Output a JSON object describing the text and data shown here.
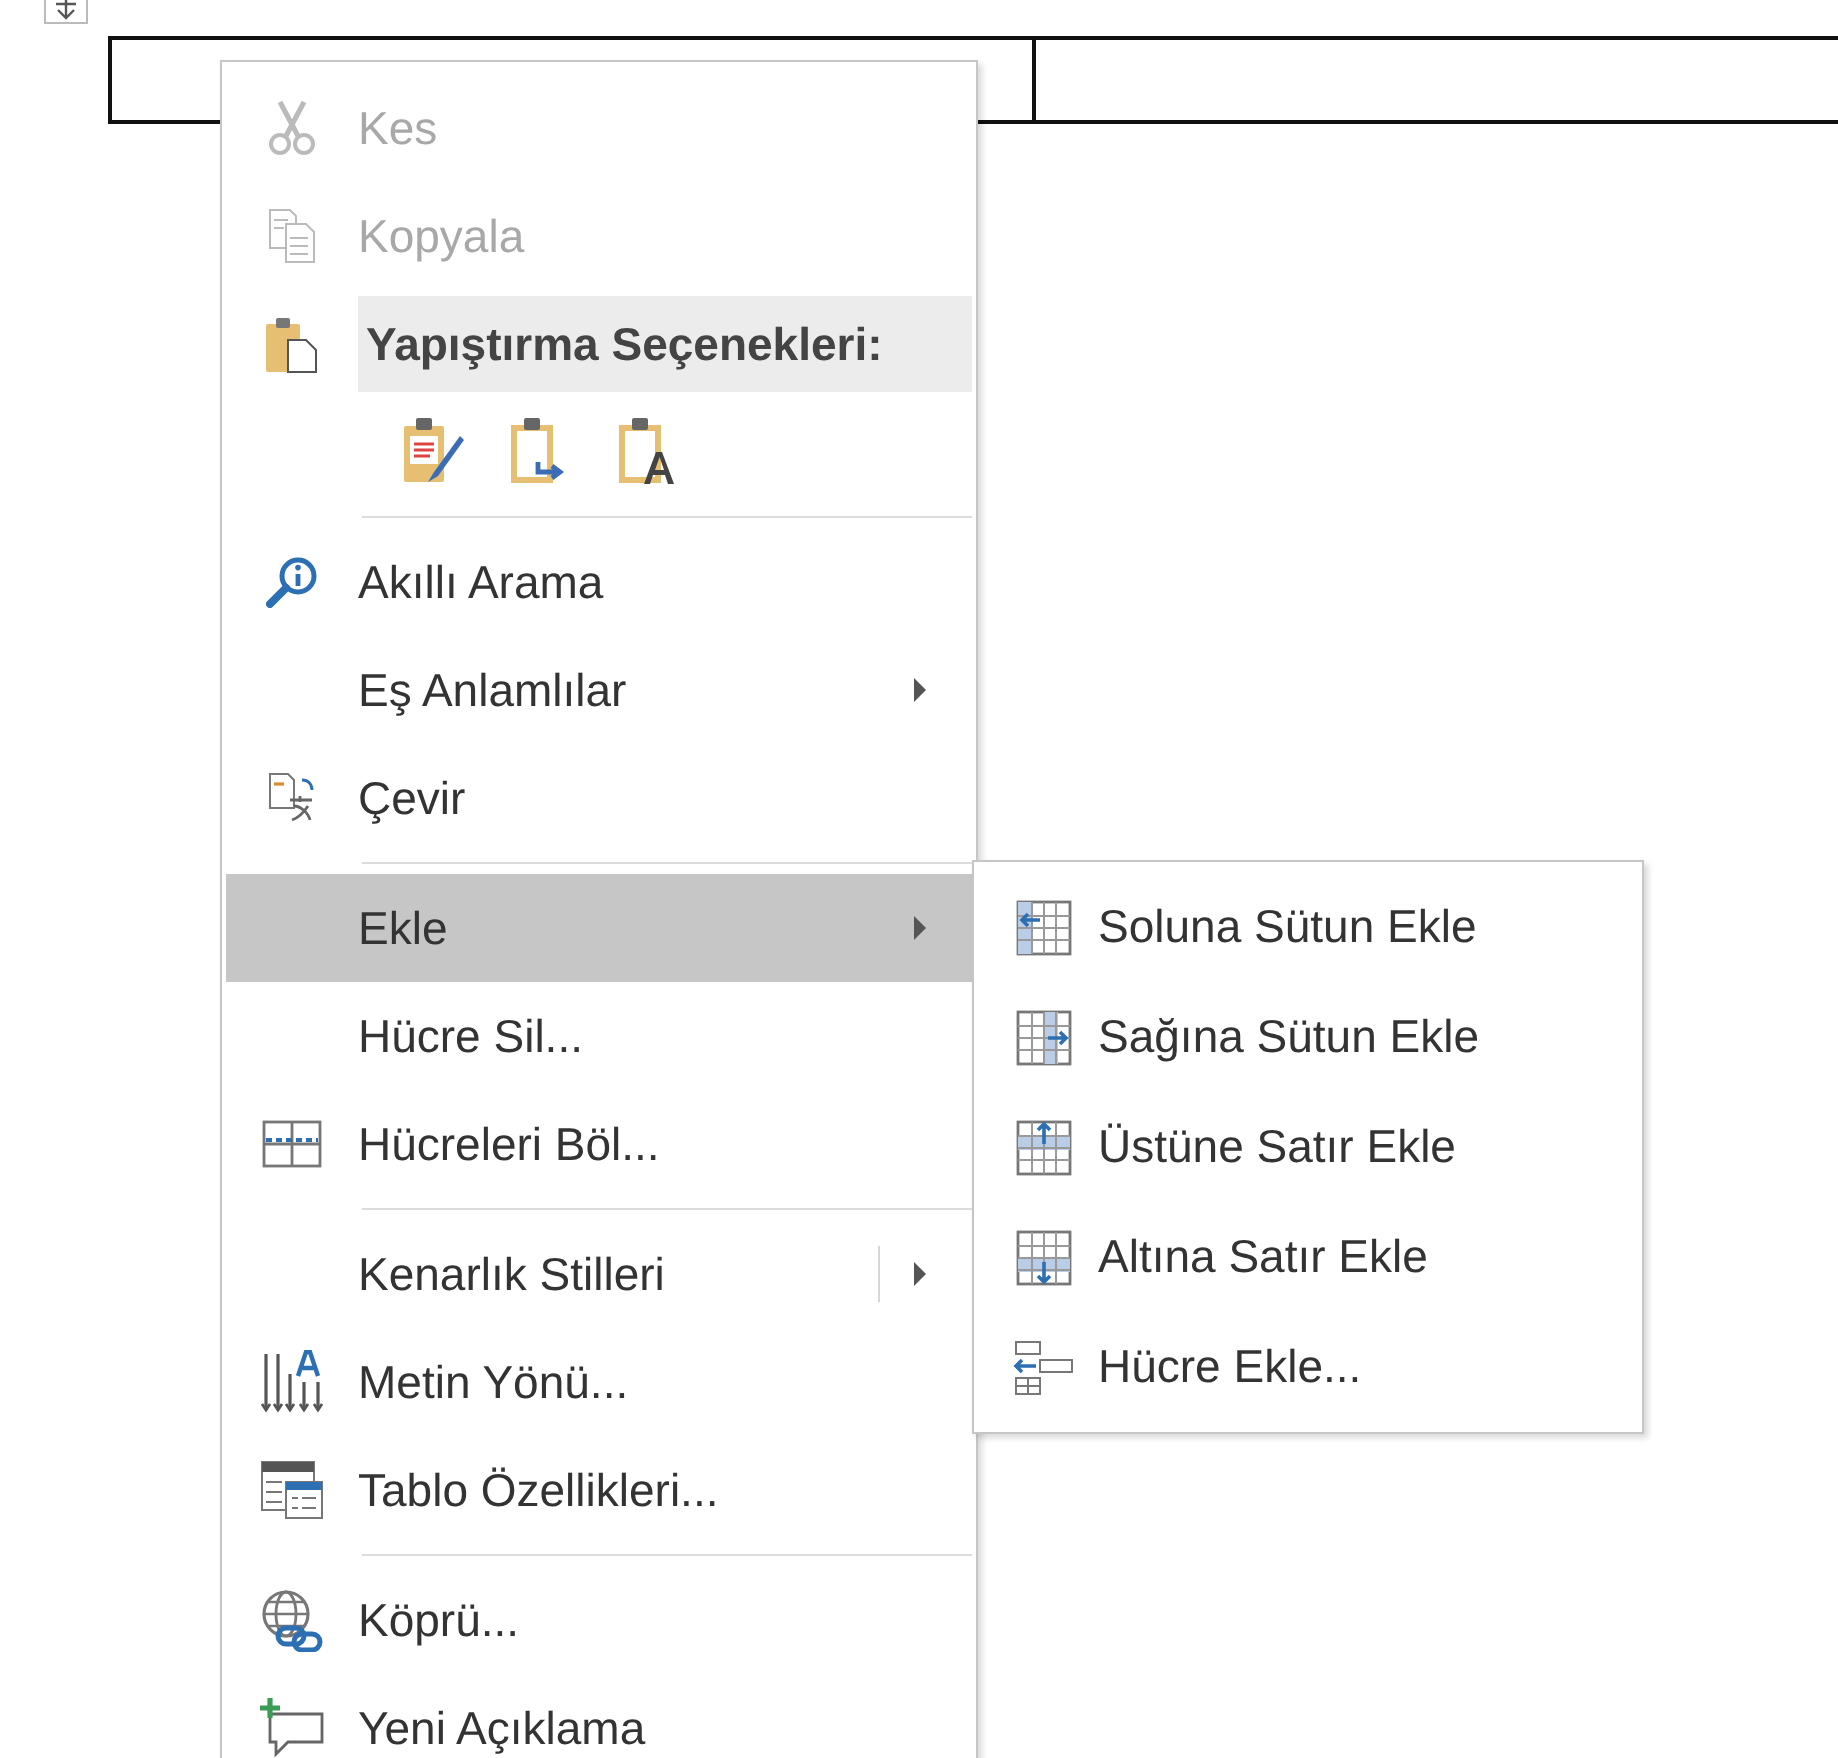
{
  "menu": {
    "groups": [
      [
        {
          "kind": "command",
          "label": "Kes",
          "disabled": true,
          "selected": false,
          "submenu": false
        },
        {
          "kind": "command",
          "label": "Kopyala",
          "disabled": true,
          "selected": false,
          "submenu": false
        },
        {
          "kind": "header",
          "label": "Yapıştırma Seçenekleri:"
        },
        {
          "kind": "paste_options",
          "options": [
            {
              "kind": "keep_formatting"
            },
            {
              "kind": "merge_formatting"
            },
            {
              "kind": "text_only"
            }
          ]
        }
      ],
      [
        {
          "kind": "command",
          "label": "Akıllı Arama",
          "disabled": false,
          "selected": false,
          "submenu": false
        },
        {
          "kind": "command",
          "label": "Eş Anlamlılar",
          "disabled": false,
          "selected": false,
          "submenu": true
        },
        {
          "kind": "command",
          "label": "Çevir",
          "disabled": false,
          "selected": false,
          "submenu": false
        }
      ],
      [
        {
          "kind": "command",
          "label": "Ekle",
          "disabled": false,
          "selected": true,
          "submenu": true
        },
        {
          "kind": "command",
          "label": "Hücre Sil...",
          "disabled": false,
          "selected": false,
          "submenu": false
        },
        {
          "kind": "command",
          "label": "Hücreleri Böl...",
          "disabled": false,
          "selected": false,
          "submenu": false
        }
      ],
      [
        {
          "kind": "split",
          "label": "Kenarlık Stilleri",
          "disabled": false,
          "selected": false,
          "submenu": true
        },
        {
          "kind": "command",
          "label": "Metin Yönü...",
          "disabled": false,
          "selected": false,
          "submenu": false
        },
        {
          "kind": "command",
          "label": "Tablo Özellikleri...",
          "disabled": false,
          "selected": false,
          "submenu": false
        }
      ],
      [
        {
          "kind": "command",
          "label": "Köprü...",
          "disabled": false,
          "selected": false,
          "submenu": false
        },
        {
          "kind": "command",
          "label": "Yeni Açıklama",
          "disabled": false,
          "selected": false,
          "submenu": false
        }
      ]
    ]
  },
  "submenu": {
    "items": [
      {
        "label": "Soluna Sütun Ekle"
      },
      {
        "label": "Sağına Sütun Ekle"
      },
      {
        "label": "Üstüne Satır Ekle"
      },
      {
        "label": "Altına Satır Ekle"
      },
      {
        "label": "Hücre Ekle..."
      }
    ]
  }
}
